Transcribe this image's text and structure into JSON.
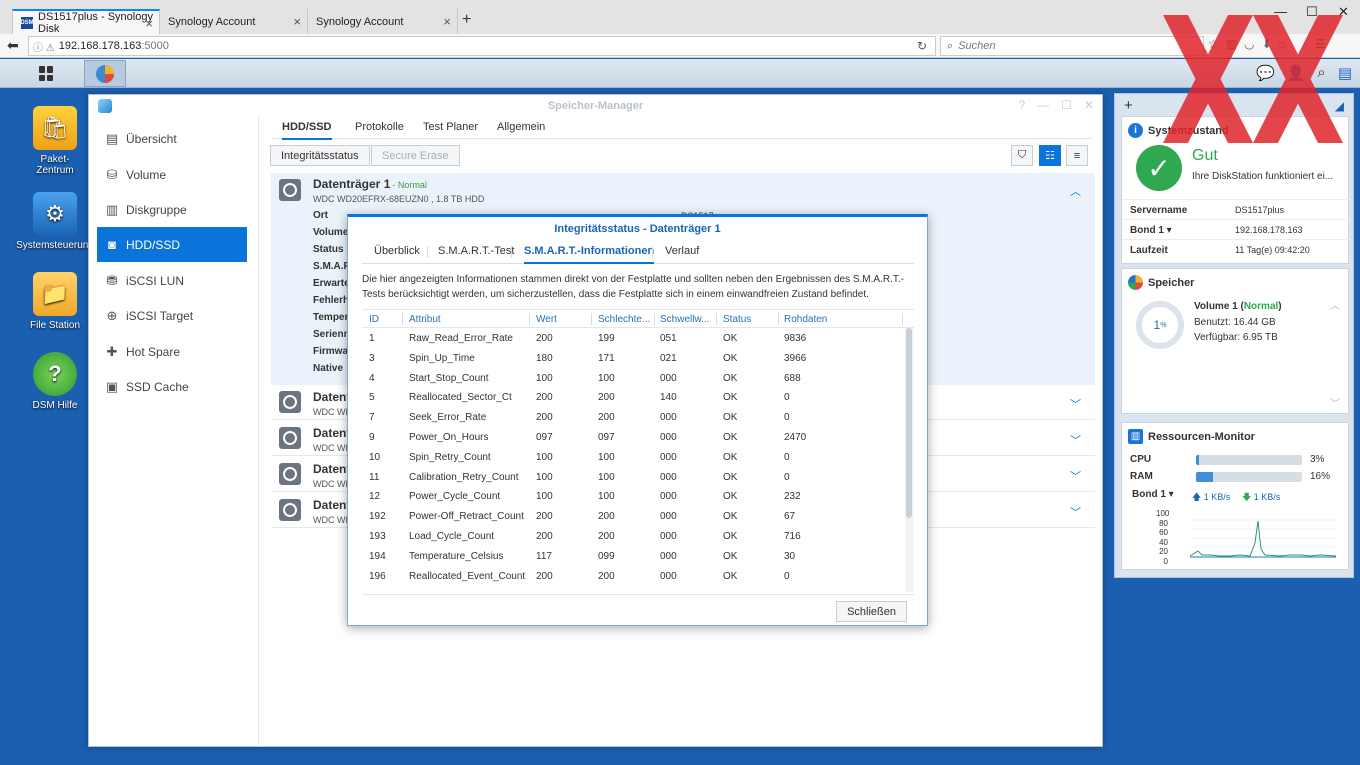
{
  "browser": {
    "tabs": [
      {
        "label": "DS1517plus - Synology Disk",
        "active": true
      },
      {
        "label": "Synology Account",
        "active": false
      },
      {
        "label": "Synology Account",
        "active": false
      }
    ],
    "url_host": "192.168.178.163",
    "url_port": ":5000",
    "search_placeholder": "Suchen"
  },
  "desktop": {
    "icons": [
      {
        "label": "Paket-\nZentrum"
      },
      {
        "label": "Systemsteuerung"
      },
      {
        "label": "File Station"
      },
      {
        "label": "DSM Hilfe"
      }
    ]
  },
  "window": {
    "title": "Speicher-Manager",
    "sidebar": [
      {
        "label": "Übersicht",
        "icon": "overview-icon"
      },
      {
        "label": "Volume",
        "icon": "volume-icon"
      },
      {
        "label": "Diskgruppe",
        "icon": "diskgroup-icon"
      },
      {
        "label": "HDD/SSD",
        "icon": "hdd-icon",
        "active": true
      },
      {
        "label": "iSCSI LUN",
        "icon": "lun-icon"
      },
      {
        "label": "iSCSI Target",
        "icon": "target-icon"
      },
      {
        "label": "Hot Spare",
        "icon": "hotspare-icon"
      },
      {
        "label": "SSD Cache",
        "icon": "cache-icon"
      }
    ],
    "tabs": [
      "HDD/SSD",
      "Protokolle",
      "Test Planer",
      "Allgemein"
    ],
    "toolbar": {
      "integrity": "Integritätsstatus",
      "secure_erase": "Secure Erase"
    },
    "disk1": {
      "name": "Datenträger 1",
      "status": "- Normal",
      "model": "WDC WD20EFRX-68EUZN0 , 1.8 TB HDD",
      "props": [
        "Ort",
        "Volume",
        "Status",
        "S.M.A.R",
        "Erwarte",
        "Fehlerh",
        "Temper",
        "Serienn",
        "Firmwa",
        "Native"
      ],
      "ort_value": "DS1517"
    },
    "other_disks": [
      {
        "name": "Datent",
        "model": "WDC WD"
      },
      {
        "name": "Datent",
        "model": "WDC WD"
      },
      {
        "name": "Datent",
        "model": "WDC WD"
      },
      {
        "name": "Datent",
        "model": "WDC WD"
      }
    ]
  },
  "dialog": {
    "title": "Integritätsstatus - Datenträger 1",
    "tabs": [
      "Überblick",
      "S.M.A.R.T.-Test",
      "S.M.A.R.T.-Informationen",
      "Verlauf"
    ],
    "description": "Die hier angezeigten Informationen stammen direkt von der Festplatte und sollten neben den Ergebnissen des S.M.A.R.T.-Tests berücksichtigt werden, um sicherzustellen, dass die Festplatte sich in einem einwandfreien Zustand befindet.",
    "columns": [
      "ID",
      "Attribut",
      "Wert",
      "Schlechte...",
      "Schwellw...",
      "Status",
      "Rohdaten"
    ],
    "rows": [
      [
        "1",
        "Raw_Read_Error_Rate",
        "200",
        "199",
        "051",
        "OK",
        "9836"
      ],
      [
        "3",
        "Spin_Up_Time",
        "180",
        "171",
        "021",
        "OK",
        "3966"
      ],
      [
        "4",
        "Start_Stop_Count",
        "100",
        "100",
        "000",
        "OK",
        "688"
      ],
      [
        "5",
        "Reallocated_Sector_Ct",
        "200",
        "200",
        "140",
        "OK",
        "0"
      ],
      [
        "7",
        "Seek_Error_Rate",
        "200",
        "200",
        "000",
        "OK",
        "0"
      ],
      [
        "9",
        "Power_On_Hours",
        "097",
        "097",
        "000",
        "OK",
        "2470"
      ],
      [
        "10",
        "Spin_Retry_Count",
        "100",
        "100",
        "000",
        "OK",
        "0"
      ],
      [
        "11",
        "Calibration_Retry_Count",
        "100",
        "100",
        "000",
        "OK",
        "0"
      ],
      [
        "12",
        "Power_Cycle_Count",
        "100",
        "100",
        "000",
        "OK",
        "232"
      ],
      [
        "192",
        "Power-Off_Retract_Count",
        "200",
        "200",
        "000",
        "OK",
        "67"
      ],
      [
        "193",
        "Load_Cycle_Count",
        "200",
        "200",
        "000",
        "OK",
        "716"
      ],
      [
        "194",
        "Temperature_Celsius",
        "117",
        "099",
        "000",
        "OK",
        "30"
      ],
      [
        "196",
        "Reallocated_Event_Count",
        "200",
        "200",
        "000",
        "OK",
        "0"
      ]
    ],
    "close_label": "Schließen"
  },
  "widgets": {
    "system": {
      "title": "Systemzustand",
      "status": "Gut",
      "status_text": "Ihre DiskStation funktioniert ei...",
      "rows": [
        {
          "k": "Servername",
          "v": "DS1517plus"
        },
        {
          "k": "Bond 1 ▾",
          "v": "192.168.178.163"
        },
        {
          "k": "Laufzeit",
          "v": "11 Tag(e) 09:42:20"
        }
      ]
    },
    "storage": {
      "title": "Speicher",
      "percent": "1",
      "percent_unit": "%",
      "volume": "Volume 1 (",
      "volume_status": "Normal",
      "volume_close": ")",
      "used": "Benutzt: 16.44 GB",
      "free": "Verfügbar: 6.95 TB"
    },
    "resources": {
      "title": "Ressourcen-Monitor",
      "cpu_label": "CPU",
      "cpu_value": "3%",
      "cpu_fraction": 0.03,
      "ram_label": "RAM",
      "ram_value": "16%",
      "ram_fraction": 0.16,
      "bond_label": "Bond 1 ▾",
      "up": "1 KB/s",
      "down": "1 KB/s",
      "chart_ticks": [
        "100",
        "80",
        "60",
        "40",
        "20",
        "0"
      ]
    }
  },
  "colors": {
    "accent": "#0a74da",
    "ok": "#2fa84f",
    "desktop": "#1a5fb0"
  }
}
